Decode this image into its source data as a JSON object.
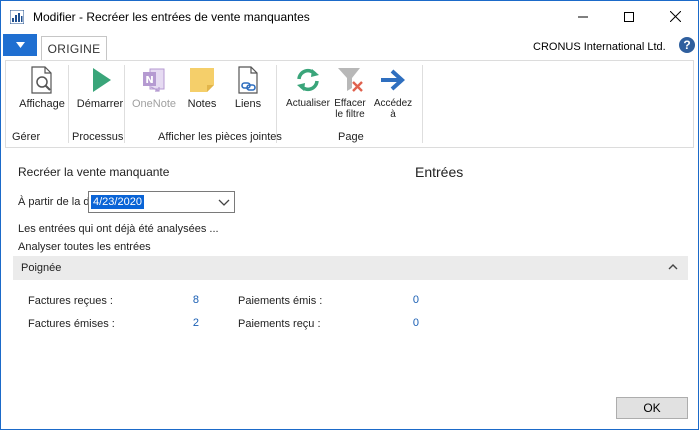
{
  "window": {
    "title": "Modifier - Recréer les entrées de vente manquantes",
    "company": "CRONUS International Ltd.",
    "help_glyph": "?"
  },
  "tabs": [
    {
      "label": "ORIGINE"
    }
  ],
  "ribbon": {
    "buttons": {
      "affichage": "Affichage",
      "demarrer": "Démarrer",
      "onenote": "OneNote",
      "notes": "Notes",
      "liens": "Liens",
      "actualiser": "Actualiser",
      "effacer_filtre": "Effacer le filtre",
      "accedez": "Accédez à"
    },
    "groups": {
      "gerer": "Gérer",
      "processus": "Processus",
      "pieces_jointes": "Afficher les pièces jointes",
      "page": "Page"
    },
    "icons": {
      "affichage": "view-document-icon",
      "demarrer": "play-icon",
      "onenote": "onenote-icon",
      "notes": "note-icon",
      "liens": "link-document-icon",
      "actualiser": "refresh-icon",
      "effacer_filtre": "clear-filter-icon",
      "accedez": "arrow-right-icon"
    }
  },
  "form": {
    "heading": "Recréer la vente manquante",
    "entries_heading": "Entrées",
    "date_label": "À partir de la date",
    "date_value": "4/23/2020",
    "line1": "Les entrées qui ont déjà été analysées ...",
    "line2": "Analyser toutes les entrées"
  },
  "fasttab": {
    "title": "Poignée",
    "stats": [
      {
        "label": "Factures reçues :",
        "value": "8"
      },
      {
        "label": "Factures émises :",
        "value": "2"
      },
      {
        "label": "Paiements émis :",
        "value": "0"
      },
      {
        "label": "Paiements reçu :",
        "value": "0"
      }
    ]
  },
  "footer": {
    "ok_label": "OK"
  },
  "colors": {
    "accent": "#1f6fd1",
    "link_value": "#1a5fb4",
    "play_green": "#3aa57a",
    "onenote_purple": "#b59ad1",
    "note_yellow": "#f5cf6a",
    "refresh_green": "#3aa57a",
    "arrow_blue": "#2f6fbf"
  }
}
